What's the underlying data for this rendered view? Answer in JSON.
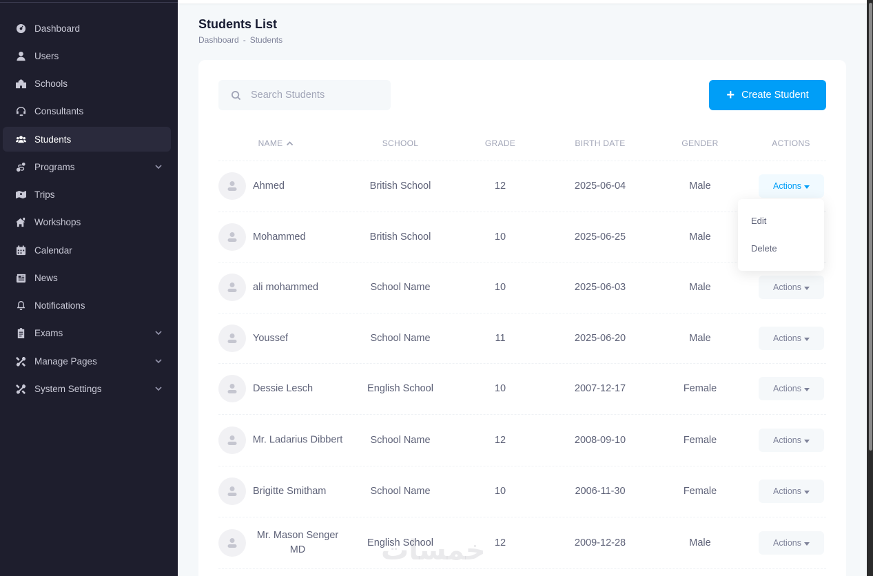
{
  "sidebar": {
    "items": [
      {
        "label": "Dashboard",
        "icon": "dashboard-icon"
      },
      {
        "label": "Users",
        "icon": "user-icon"
      },
      {
        "label": "Schools",
        "icon": "school-icon"
      },
      {
        "label": "Consultants",
        "icon": "headset-icon"
      },
      {
        "label": "Students",
        "icon": "users-group-icon",
        "active": true
      },
      {
        "label": "Programs",
        "icon": "programs-icon",
        "expandable": true
      },
      {
        "label": "Trips",
        "icon": "map-icon"
      },
      {
        "label": "Workshops",
        "icon": "workshop-icon"
      },
      {
        "label": "Calendar",
        "icon": "calendar-icon"
      },
      {
        "label": "News",
        "icon": "newspaper-icon"
      },
      {
        "label": "Notifications",
        "icon": "bell-icon"
      },
      {
        "label": "Exams",
        "icon": "clipboard-icon",
        "expandable": true
      },
      {
        "label": "Manage Pages",
        "icon": "tools-icon",
        "expandable": true
      },
      {
        "label": "System Settings",
        "icon": "tools-icon",
        "expandable": true
      }
    ]
  },
  "header": {
    "title": "Students List",
    "breadcrumb": [
      "Dashboard",
      "-",
      "Students"
    ]
  },
  "toolbar": {
    "search_placeholder": "Search Students",
    "create_label": "Create Student"
  },
  "table": {
    "columns": [
      "NAME",
      "SCHOOL",
      "GRADE",
      "BIRTH DATE",
      "GENDER",
      "ACTIONS"
    ],
    "sorted_column": "NAME",
    "sort_direction": "asc",
    "rows": [
      {
        "name": "Ahmed",
        "school": "British School",
        "grade": "12",
        "birth_date": "2025-06-04",
        "gender": "Male",
        "action": "Actions"
      },
      {
        "name": "Mohammed",
        "school": "British School",
        "grade": "10",
        "birth_date": "2025-06-25",
        "gender": "Male",
        "action": "Actions"
      },
      {
        "name": "ali mohammed",
        "school": "School Name",
        "grade": "10",
        "birth_date": "2025-06-03",
        "gender": "Male",
        "action": "Actions"
      },
      {
        "name": "Youssef",
        "school": "School Name",
        "grade": "11",
        "birth_date": "2025-06-20",
        "gender": "Male",
        "action": "Actions"
      },
      {
        "name": "Dessie Lesch",
        "school": "English School",
        "grade": "10",
        "birth_date": "2007-12-17",
        "gender": "Female",
        "action": "Actions"
      },
      {
        "name": "Mr. Ladarius Dibbert",
        "school": "School Name",
        "grade": "12",
        "birth_date": "2008-09-10",
        "gender": "Female",
        "action": "Actions"
      },
      {
        "name": "Brigitte Smitham",
        "school": "School Name",
        "grade": "10",
        "birth_date": "2006-11-30",
        "gender": "Female",
        "action": "Actions"
      },
      {
        "name": "Mr. Mason Senger MD",
        "school": "English School",
        "grade": "12",
        "birth_date": "2009-12-28",
        "gender": "Male",
        "action": "Actions"
      }
    ]
  },
  "dropdown": {
    "items": [
      "Edit",
      "Delete"
    ]
  },
  "watermark": "خمسات",
  "colors": {
    "sidebar_bg": "#1e1e2d",
    "primary": "#009ef7",
    "page_bg": "#f5f8fa"
  }
}
